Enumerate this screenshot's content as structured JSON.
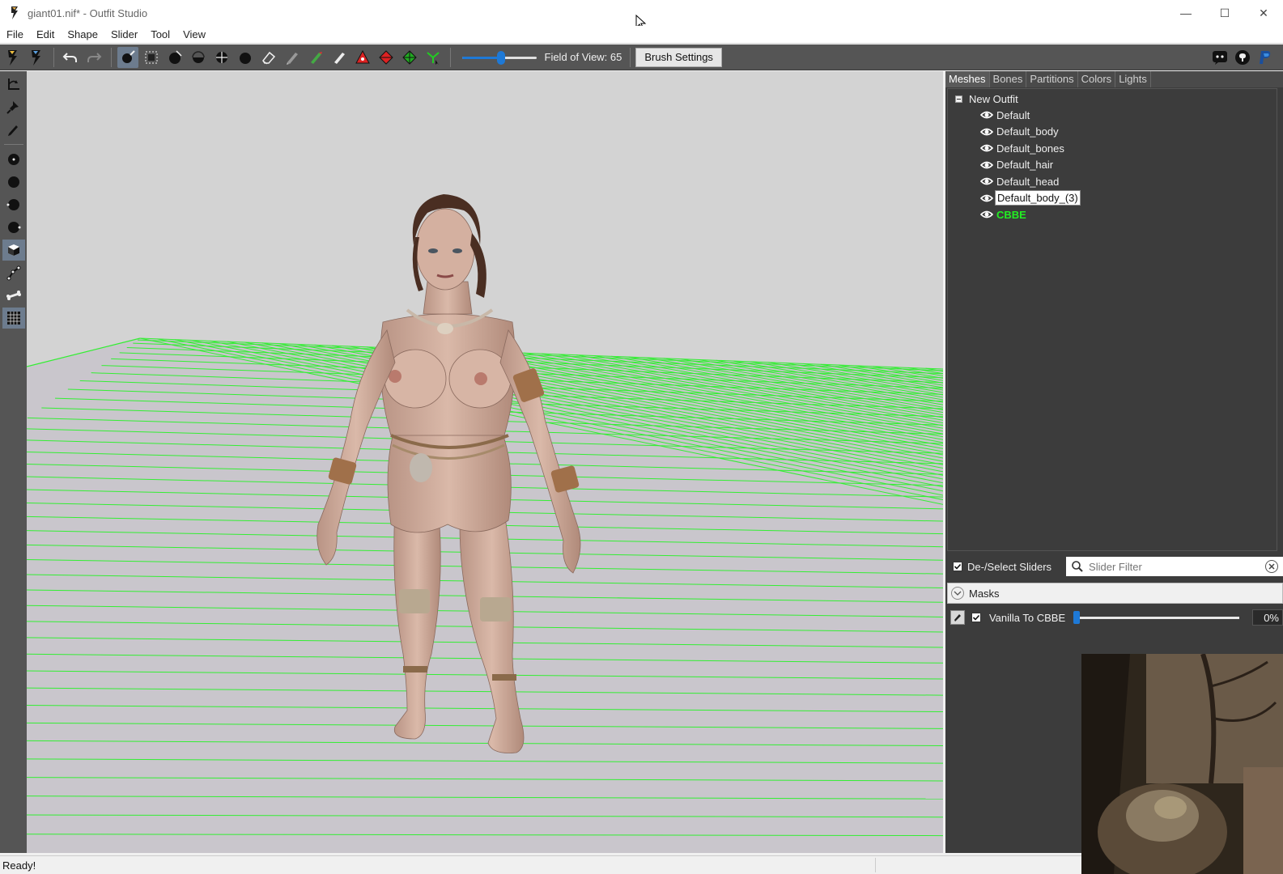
{
  "window": {
    "title": "giant01.nif* - Outfit Studio",
    "minimize": "—",
    "maximize": "☐",
    "close": "✕"
  },
  "menu": [
    "File",
    "Edit",
    "Shape",
    "Slider",
    "Tool",
    "View"
  ],
  "toolbar": {
    "fov_label": "Field of View: 65",
    "fov_value": 65,
    "brush_settings": "Brush Settings"
  },
  "panel": {
    "tabs": [
      "Meshes",
      "Bones",
      "Partitions",
      "Colors",
      "Lights"
    ],
    "active_tab": "Meshes",
    "root": "New Outfit",
    "meshes": [
      {
        "name": "Default"
      },
      {
        "name": "Default_body"
      },
      {
        "name": "Default_bones"
      },
      {
        "name": "Default_hair"
      },
      {
        "name": "Default_head"
      },
      {
        "name": "Default_body_(3)"
      },
      {
        "name": "CBBE"
      }
    ],
    "selected_mesh": "Default_body_(3)",
    "reference_mesh": "CBBE"
  },
  "sliders": {
    "deselect_label": "De-/Select Sliders",
    "filter_placeholder": "Slider Filter",
    "masks_label": "Masks",
    "items": [
      {
        "name": "Vanilla To CBBE",
        "value": "0%",
        "fraction": 0
      }
    ]
  },
  "status": {
    "text": "Ready!"
  },
  "colors": {
    "accent": "#1e79d6",
    "reference_mesh": "#22ee22",
    "grid": "#33ee33"
  }
}
